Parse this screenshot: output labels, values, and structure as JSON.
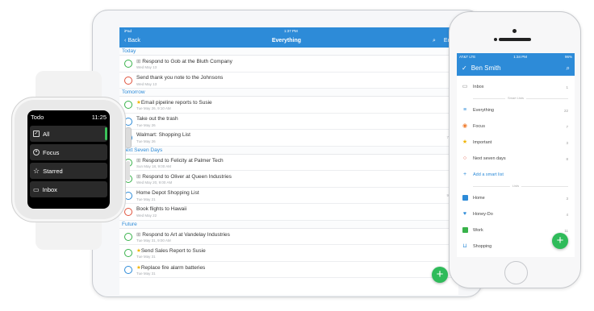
{
  "colors": {
    "accent": "#2d8bd8",
    "green": "#38b24a",
    "red": "#e0533d",
    "star": "#f0b400"
  },
  "watch": {
    "app_title": "Todo",
    "time": "11:25",
    "items": [
      {
        "label": "All",
        "icon": "checkbox-icon"
      },
      {
        "label": "Focus",
        "icon": "focus-icon"
      },
      {
        "label": "Starred",
        "icon": "star-icon"
      },
      {
        "label": "Inbox",
        "icon": "inbox-icon"
      }
    ]
  },
  "ipad": {
    "status_left": "iPad",
    "status_time": "1:37 PM",
    "back_label": "Back",
    "title": "Everything",
    "edit_label": "Edit",
    "sections": {
      "today": "Today",
      "tomorrow": "Tomorrow",
      "next_seven": "Next Seven Days",
      "future": "Future"
    },
    "rows": [
      {
        "title": "Respond to Gob at the Bluth Company",
        "sub": "Wed May 13"
      },
      {
        "title": "Send thank you note to the Johnsons",
        "sub": "Wed May 13"
      },
      {
        "title": "Email pipeline reports to Susie",
        "sub": "Tue May 26, 9:10 AM"
      },
      {
        "title": "Take out the trash",
        "sub": "Tue May 26"
      },
      {
        "title": "Walmart: Shopping List",
        "sub": "Tue May 26",
        "count": "7"
      },
      {
        "title": "Respond to Felicity at Palmer Tech",
        "sub": "Sun May 18, 9:00 AM"
      },
      {
        "title": "Respond to Oliver at Queen Industries",
        "sub": "Wed May 20, 9:00 AM"
      },
      {
        "title": "Home Depot Shopping List",
        "sub": "Tue May 21",
        "count": "9"
      },
      {
        "title": "Book flights to Hawaii",
        "sub": "Wed May 22"
      },
      {
        "title": "Respond to Art at Vandelay Industries",
        "sub": "Tue May 31, 9:00 AM"
      },
      {
        "title": "Send Sales Report to Susie",
        "sub": "Tue May 31"
      },
      {
        "title": "Replace fire alarm batteries",
        "sub": "Tue May 31"
      }
    ]
  },
  "iphone": {
    "carrier": "AT&T  LTE",
    "time": "1:34 PM",
    "battery": "96%",
    "user": "Ben Smith",
    "inbox": {
      "label": "Inbox",
      "count": "1"
    },
    "smart_lists_header": "Smart Lists",
    "smart_lists": [
      {
        "label": "Everything",
        "count": "22"
      },
      {
        "label": "Focus",
        "count": "7"
      },
      {
        "label": "Important",
        "count": "3"
      },
      {
        "label": "Next seven days",
        "count": "8"
      }
    ],
    "add_smart_list": "Add a smart list",
    "lists_header": "Lists",
    "lists": [
      {
        "label": "Home",
        "count": "3"
      },
      {
        "label": "Honey-Do",
        "count": "4"
      },
      {
        "label": "Work",
        "count": "11"
      },
      {
        "label": "Shopping",
        "count": ""
      }
    ]
  }
}
